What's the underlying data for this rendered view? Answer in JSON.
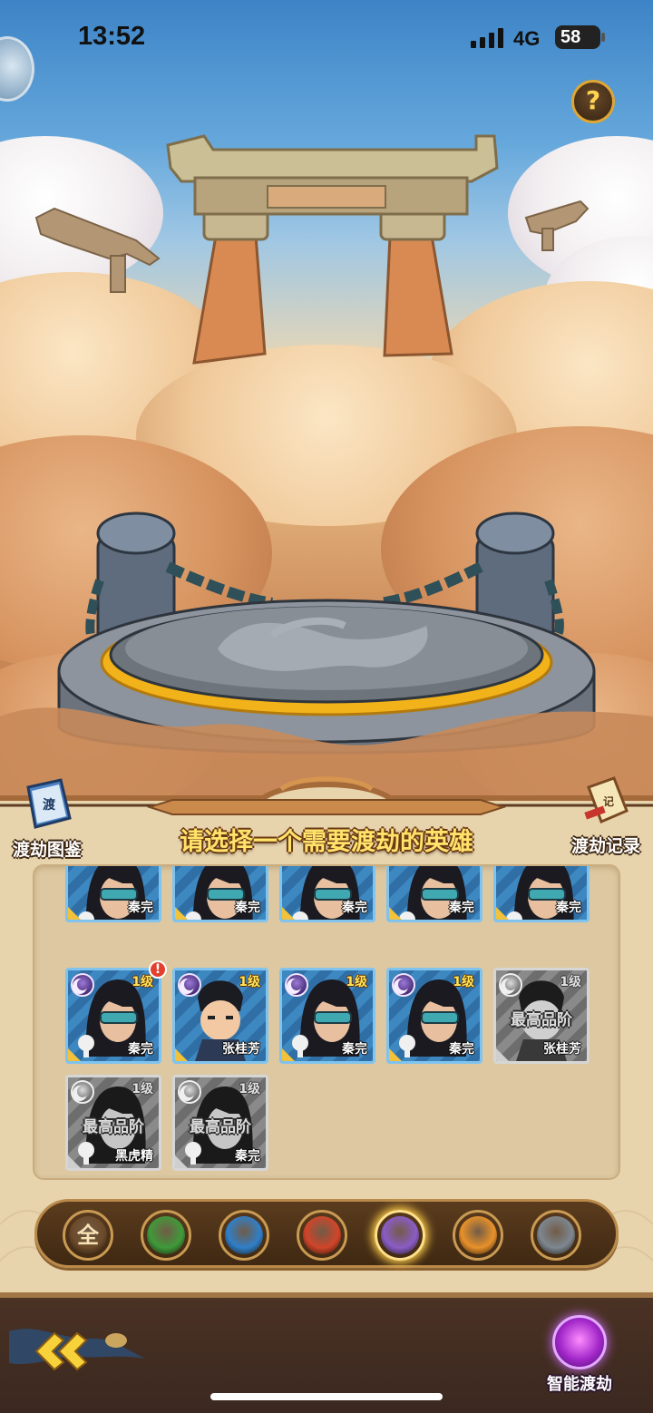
{
  "status_bar": {
    "time": "13:52",
    "network": "4G",
    "battery": "58"
  },
  "header": {
    "help_symbol": "?"
  },
  "side_buttons": {
    "left_label": "渡劫图鉴",
    "right_label": "渡劫记录"
  },
  "title": "请选择一个需要渡劫的英雄",
  "heroes": [
    {
      "name": "秦完",
      "level": "",
      "max_quality": "",
      "gray": false,
      "alert": false
    },
    {
      "name": "秦完",
      "level": "",
      "max_quality": "",
      "gray": false,
      "alert": false
    },
    {
      "name": "秦完",
      "level": "",
      "max_quality": "",
      "gray": false,
      "alert": false
    },
    {
      "name": "秦完",
      "level": "",
      "max_quality": "",
      "gray": false,
      "alert": false
    },
    {
      "name": "秦完",
      "level": "",
      "max_quality": "",
      "gray": false,
      "alert": false
    },
    {
      "name": "秦完",
      "level": "1级",
      "max_quality": "",
      "gray": false,
      "alert": true
    },
    {
      "name": "张桂芳",
      "level": "1级",
      "max_quality": "",
      "gray": false,
      "alert": false
    },
    {
      "name": "秦完",
      "level": "1级",
      "max_quality": "",
      "gray": false,
      "alert": false
    },
    {
      "name": "秦完",
      "level": "1级",
      "max_quality": "",
      "gray": false,
      "alert": false
    },
    {
      "name": "张桂芳",
      "level": "1级",
      "max_quality": "最高品阶",
      "gray": true,
      "alert": false
    },
    {
      "name": "黑虎精",
      "level": "1级",
      "max_quality": "最高品阶",
      "gray": true,
      "alert": false
    },
    {
      "name": "秦完",
      "level": "1级",
      "max_quality": "最高品阶",
      "gray": true,
      "alert": false
    }
  ],
  "filters": [
    {
      "label": "全",
      "icon": "all-icon",
      "color": "#6b4a2a"
    },
    {
      "label": "",
      "icon": "wood-leaf-icon",
      "color": "#3f9a3a"
    },
    {
      "label": "",
      "icon": "water-wave-icon",
      "color": "#2f7fc9"
    },
    {
      "label": "",
      "icon": "fire-flame-icon",
      "color": "#d0452a"
    },
    {
      "label": "",
      "icon": "moon-icon",
      "color": "#8a5cc7"
    },
    {
      "label": "",
      "icon": "sun-icon",
      "color": "#e8912a"
    },
    {
      "label": "",
      "icon": "vortex-icon",
      "color": "#7d8791"
    }
  ],
  "selected_filter_index": 4,
  "bottom": {
    "auto_label": "智能渡劫"
  },
  "colors": {
    "accent_gold": "#ffe36b",
    "panel_bg": "#ddc8a1",
    "bottom_bar": "#3b2820"
  }
}
